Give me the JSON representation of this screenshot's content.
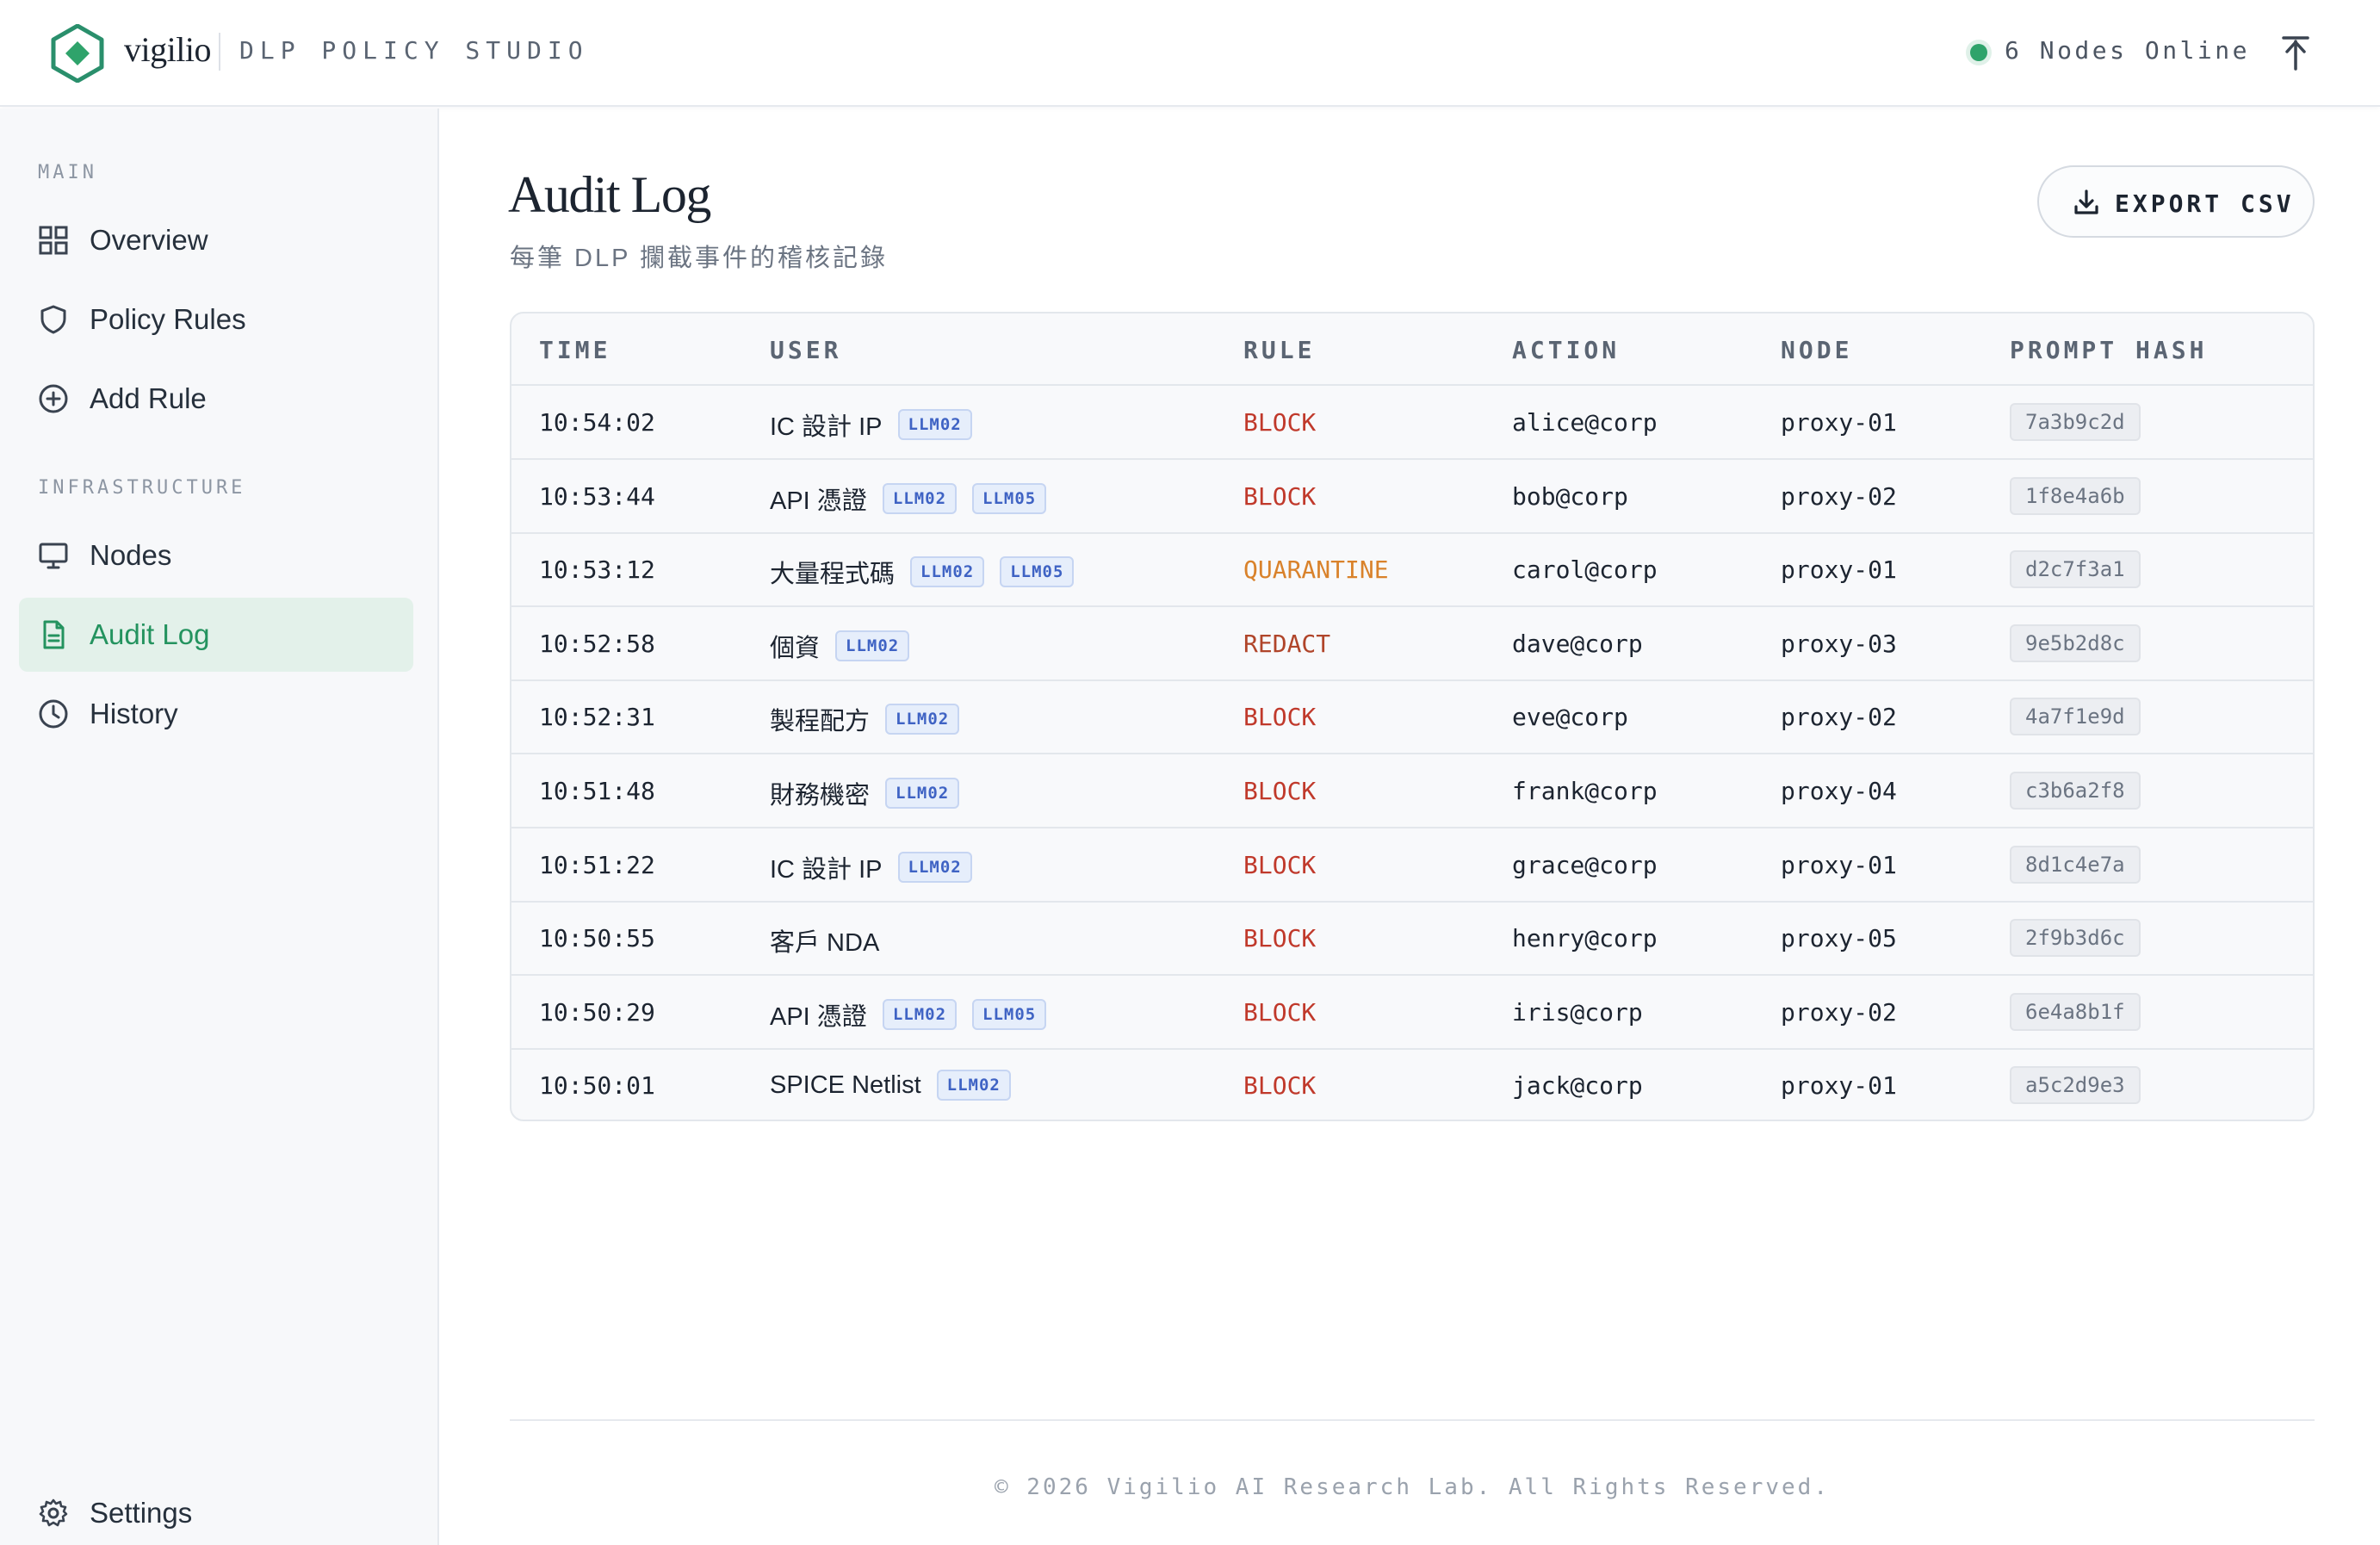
{
  "header": {
    "brand": "vigilio",
    "product": "DLP POLICY STUDIO",
    "status_text": "6 Nodes Online",
    "accent": "#2fa36b"
  },
  "sidebar": {
    "sections": [
      {
        "label": "MAIN"
      },
      {
        "label": "INFRASTRUCTURE"
      }
    ],
    "items": [
      {
        "label": "Overview",
        "icon": "grid-icon"
      },
      {
        "label": "Policy Rules",
        "icon": "shield-icon"
      },
      {
        "label": "Add Rule",
        "icon": "plus-circle-icon"
      },
      {
        "label": "Nodes",
        "icon": "monitor-icon"
      },
      {
        "label": "Audit Log",
        "icon": "document-icon",
        "active": true
      },
      {
        "label": "History",
        "icon": "clock-icon"
      }
    ],
    "settings_label": "Settings"
  },
  "main": {
    "title": "Audit Log",
    "subtitle": "每筆 DLP 攔截事件的稽核記錄",
    "export_label": "EXPORT CSV"
  },
  "table": {
    "columns": [
      "TIME",
      "USER",
      "RULE",
      "ACTION",
      "NODE",
      "PROMPT HASH"
    ],
    "rows": [
      {
        "time": "10:54:02",
        "user": "IC 設計 IP",
        "tags": [
          "LLM02"
        ],
        "rule": "BLOCK",
        "action": "alice@corp",
        "node": "proxy-01",
        "hash": "7a3b9c2d"
      },
      {
        "time": "10:53:44",
        "user": "API 憑證",
        "tags": [
          "LLM02",
          "LLM05"
        ],
        "rule": "BLOCK",
        "action": "bob@corp",
        "node": "proxy-02",
        "hash": "1f8e4a6b"
      },
      {
        "time": "10:53:12",
        "user": "大量程式碼",
        "tags": [
          "LLM02",
          "LLM05"
        ],
        "rule": "QUARANTINE",
        "action": "carol@corp",
        "node": "proxy-01",
        "hash": "d2c7f3a1"
      },
      {
        "time": "10:52:58",
        "user": "個資",
        "tags": [
          "LLM02"
        ],
        "rule": "REDACT",
        "action": "dave@corp",
        "node": "proxy-03",
        "hash": "9e5b2d8c"
      },
      {
        "time": "10:52:31",
        "user": "製程配方",
        "tags": [
          "LLM02"
        ],
        "rule": "BLOCK",
        "action": "eve@corp",
        "node": "proxy-02",
        "hash": "4a7f1e9d"
      },
      {
        "time": "10:51:48",
        "user": "財務機密",
        "tags": [
          "LLM02"
        ],
        "rule": "BLOCK",
        "action": "frank@corp",
        "node": "proxy-04",
        "hash": "c3b6a2f8"
      },
      {
        "time": "10:51:22",
        "user": "IC 設計 IP",
        "tags": [
          "LLM02"
        ],
        "rule": "BLOCK",
        "action": "grace@corp",
        "node": "proxy-01",
        "hash": "8d1c4e7a"
      },
      {
        "time": "10:50:55",
        "user": "客戶 NDA",
        "tags": [],
        "rule": "BLOCK",
        "action": "henry@corp",
        "node": "proxy-05",
        "hash": "2f9b3d6c"
      },
      {
        "time": "10:50:29",
        "user": "API 憑證",
        "tags": [
          "LLM02",
          "LLM05"
        ],
        "rule": "BLOCK",
        "action": "iris@corp",
        "node": "proxy-02",
        "hash": "6e4a8b1f"
      },
      {
        "time": "10:50:01",
        "user": "SPICE Netlist",
        "tags": [
          "LLM02"
        ],
        "rule": "BLOCK",
        "action": "jack@corp",
        "node": "proxy-01",
        "hash": "a5c2d9e3"
      }
    ]
  },
  "footer": "© 2026 Vigilio AI Research Lab. All Rights Reserved."
}
